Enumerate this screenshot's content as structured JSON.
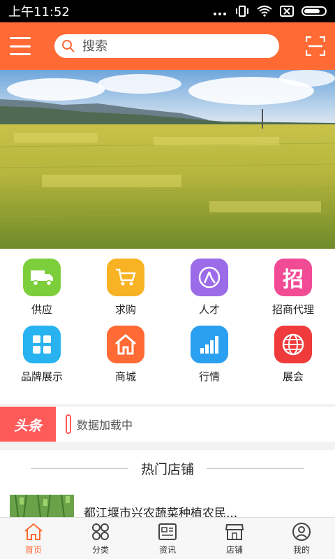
{
  "status_bar": {
    "time": "上午11:52"
  },
  "header": {
    "search_placeholder": "搜索",
    "accent": "#ff6a35"
  },
  "grid": {
    "items": [
      {
        "label": "供应",
        "icon": "truck-icon",
        "color": "#7ccf3a"
      },
      {
        "label": "求购",
        "icon": "cart-icon",
        "color": "#f7b323"
      },
      {
        "label": "人才",
        "icon": "person-icon",
        "color": "#9b6be8"
      },
      {
        "label": "招商代理",
        "icon": "zhao-icon",
        "color": "#f24b95"
      },
      {
        "label": "品牌展示",
        "icon": "tiles-icon",
        "color": "#28b2f0"
      },
      {
        "label": "商城",
        "icon": "home-icon",
        "color": "#ff6a35"
      },
      {
        "label": "行情",
        "icon": "bar-chart-icon",
        "color": "#2b9ff0"
      },
      {
        "label": "展会",
        "icon": "globe-icon",
        "color": "#ef3b3b"
      }
    ],
    "zhao_char": "招"
  },
  "headline": {
    "tag": "头条",
    "text": "数据加载中"
  },
  "hot_shops": {
    "title": "热门店铺",
    "items": [
      {
        "name": "都江堰市兴农蔬菜种植农民..."
      }
    ]
  },
  "bottom_nav": {
    "items": [
      {
        "label": "首页",
        "icon": "home-outline-icon",
        "active": true
      },
      {
        "label": "分类",
        "icon": "category-icon",
        "active": false
      },
      {
        "label": "资讯",
        "icon": "news-icon",
        "active": false
      },
      {
        "label": "店铺",
        "icon": "shop-icon",
        "active": false
      },
      {
        "label": "我的",
        "icon": "user-icon",
        "active": false
      }
    ]
  }
}
